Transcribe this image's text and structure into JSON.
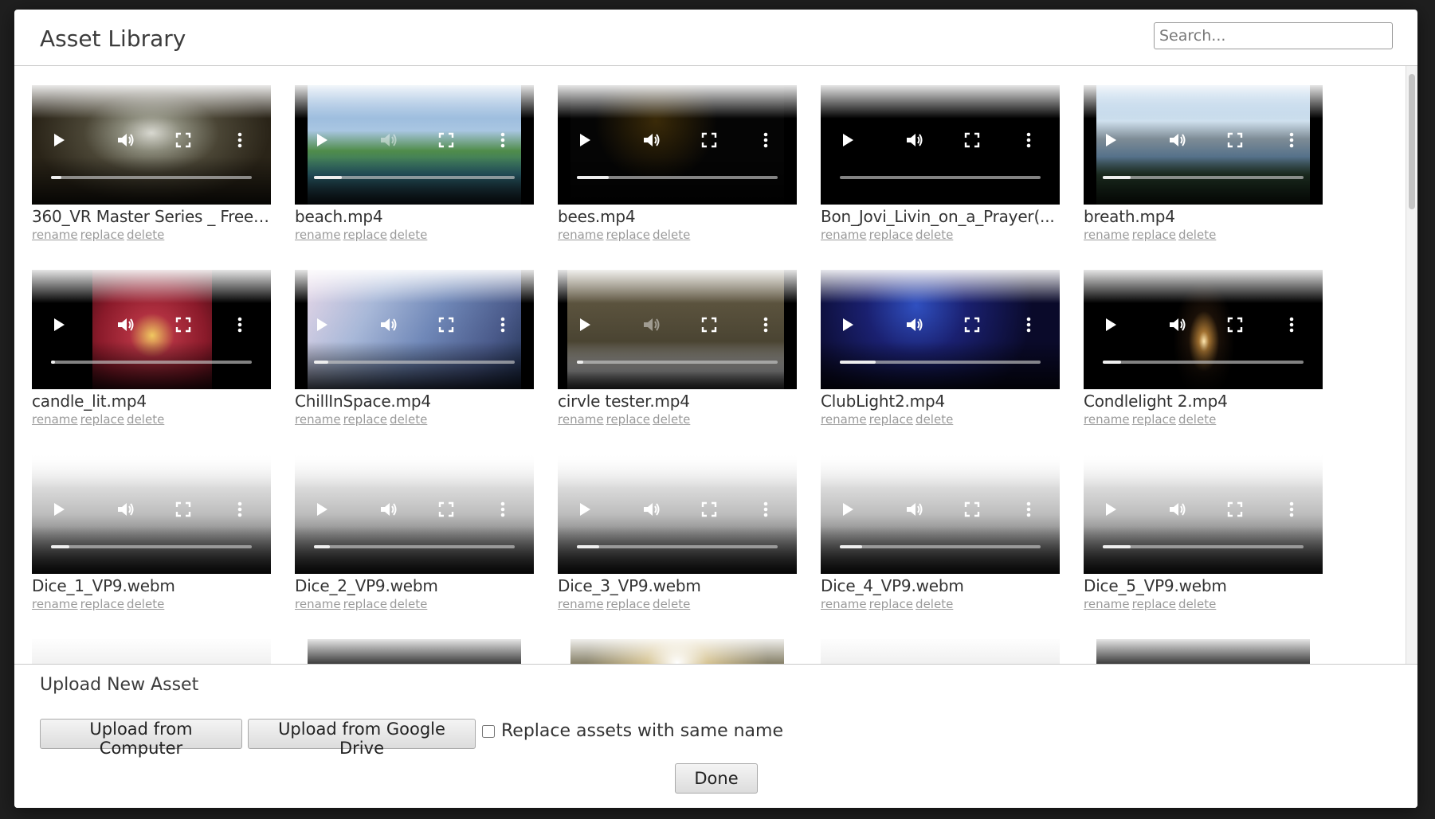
{
  "modal": {
    "title": "Asset Library",
    "search_placeholder": "Search..."
  },
  "assets": [
    {
      "name": "360_VR Master Series _ Free ...",
      "muted": false,
      "progress": 0.05
    },
    {
      "name": "beach.mp4",
      "muted": true,
      "progress": 0.14
    },
    {
      "name": "bees.mp4",
      "muted": false,
      "progress": 0.16
    },
    {
      "name": "Bon_Jovi_Livin_on_a_Prayer(...",
      "muted": false,
      "progress": 0.0
    },
    {
      "name": "breath.mp4",
      "muted": false,
      "progress": 0.14
    },
    {
      "name": "candle_lit.mp4",
      "muted": false,
      "progress": 0.02
    },
    {
      "name": "ChillInSpace.mp4",
      "muted": false,
      "progress": 0.07
    },
    {
      "name": "cirvle tester.mp4",
      "muted": true,
      "progress": 0.03
    },
    {
      "name": "ClubLight2.mp4",
      "muted": false,
      "progress": 0.18
    },
    {
      "name": "Condlelight 2.mp4",
      "muted": false,
      "progress": 0.09
    },
    {
      "name": "Dice_1_VP9.webm",
      "muted": false,
      "progress": 0.09
    },
    {
      "name": "Dice_2_VP9.webm",
      "muted": false,
      "progress": 0.08
    },
    {
      "name": "Dice_3_VP9.webm",
      "muted": false,
      "progress": 0.11
    },
    {
      "name": "Dice_4_VP9.webm",
      "muted": false,
      "progress": 0.11
    },
    {
      "name": "Dice_5_VP9.webm",
      "muted": false,
      "progress": 0.14
    },
    {
      "name": "",
      "muted": false,
      "progress": 0
    },
    {
      "name": "",
      "muted": false,
      "progress": 0
    },
    {
      "name": "",
      "muted": false,
      "progress": 0
    },
    {
      "name": "",
      "muted": false,
      "progress": 0
    },
    {
      "name": "",
      "muted": false,
      "progress": 0
    }
  ],
  "actions": {
    "rename": "rename",
    "replace": "replace",
    "delete": "delete"
  },
  "footer": {
    "upload_title": "Upload New Asset",
    "upload_computer": "Upload from Computer",
    "upload_drive": "Upload from Google Drive",
    "replace_label": "Replace assets with same name",
    "replace_checked": false,
    "done": "Done"
  },
  "icons": {
    "play": "play-icon",
    "volume": "volume-icon",
    "fullscreen": "fullscreen-icon",
    "more": "more-vertical-icon"
  }
}
